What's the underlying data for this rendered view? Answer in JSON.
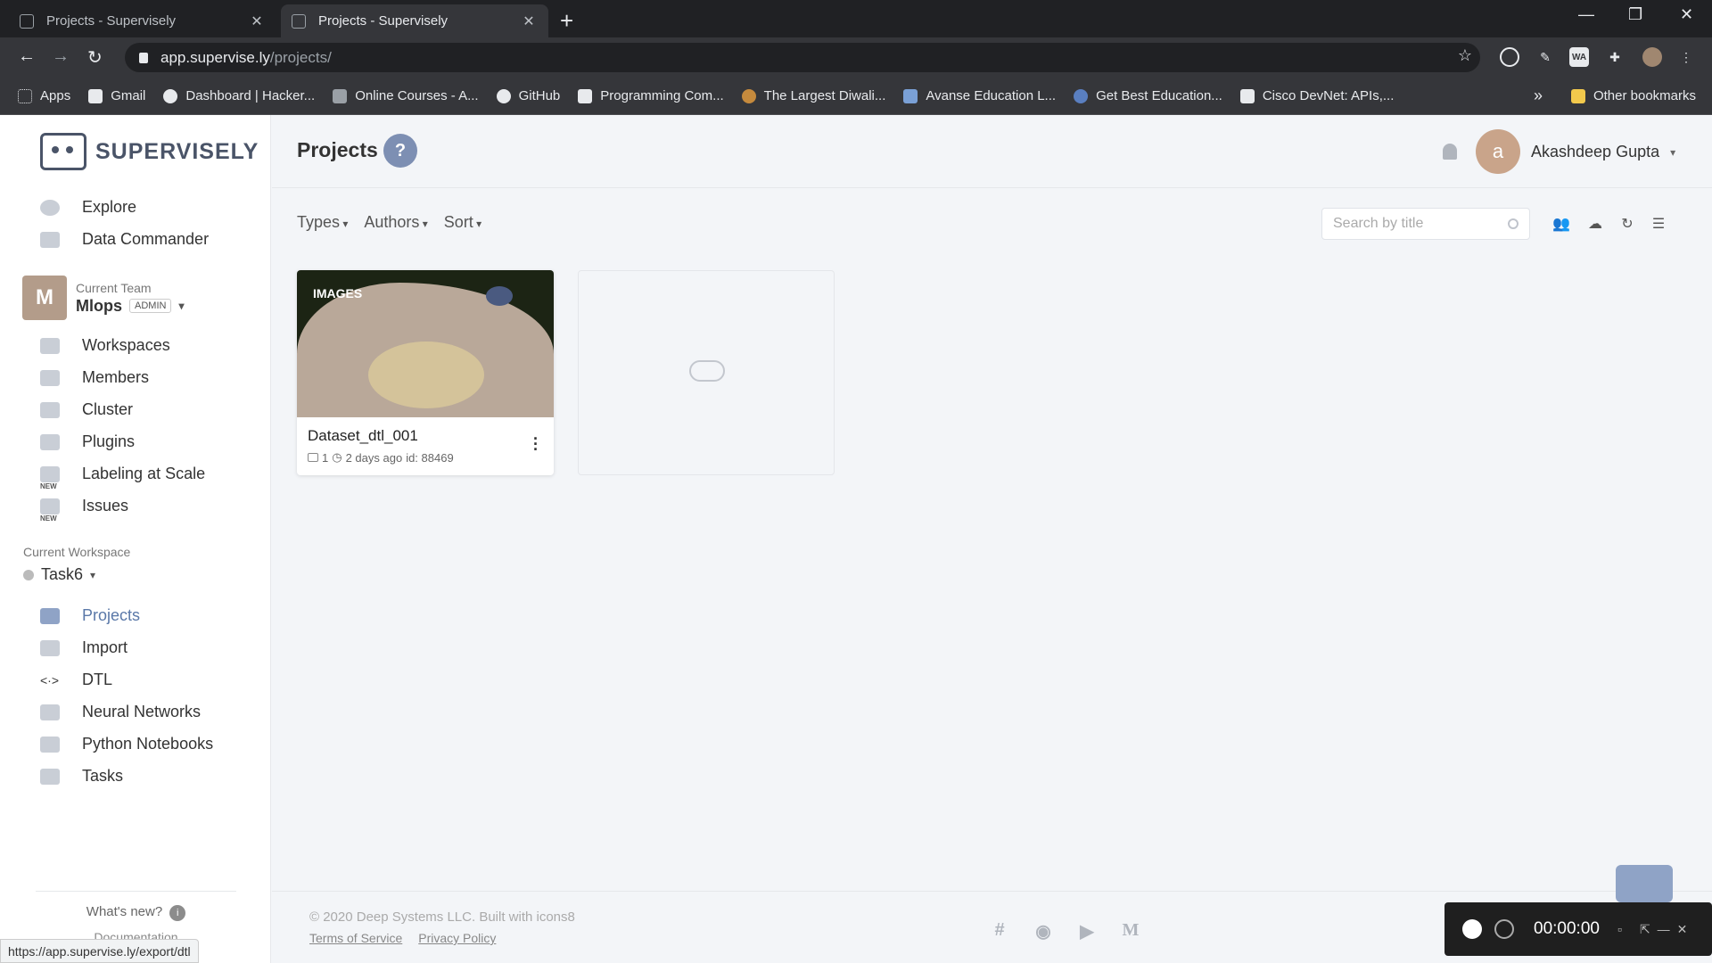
{
  "browser": {
    "tabs": [
      {
        "title": "Projects - Supervisely",
        "active": false
      },
      {
        "title": "Projects - Supervisely",
        "active": true
      }
    ],
    "url_host": "app.supervise.ly",
    "url_path": "/projects/",
    "bookmarks": [
      "Apps",
      "Gmail",
      "Dashboard | Hacker...",
      "Online Courses - A...",
      "GitHub",
      "Programming Com...",
      "The Largest Diwali...",
      "Avanse Education L...",
      "Get Best Education...",
      "Cisco DevNet: APIs,..."
    ],
    "bookmarks_more": "»",
    "other_bookmarks": "Other bookmarks",
    "status_url": "https://app.supervise.ly/export/dtl"
  },
  "sidebar": {
    "logo_text": "SUPERVISELY",
    "top_items": [
      {
        "label": "Explore",
        "icon": "globe-icon"
      },
      {
        "label": "Data Commander",
        "icon": "folder-icon"
      }
    ],
    "team": {
      "label": "Current Team",
      "avatar_letter": "M",
      "name": "Mlops",
      "role": "ADMIN"
    },
    "team_items": [
      {
        "label": "Workspaces",
        "icon": "monitor-icon",
        "new": false
      },
      {
        "label": "Members",
        "icon": "users-icon",
        "new": false
      },
      {
        "label": "Cluster",
        "icon": "server-icon",
        "new": false
      },
      {
        "label": "Plugins",
        "icon": "plugin-icon",
        "new": false
      },
      {
        "label": "Labeling at Scale",
        "icon": "labeling-icon",
        "new": true
      },
      {
        "label": "Issues",
        "icon": "flag-icon",
        "new": true
      }
    ],
    "new_tag": "NEW",
    "workspace": {
      "label": "Current Workspace",
      "name": "Task6"
    },
    "workspace_items": [
      {
        "label": "Projects",
        "icon": "projects-icon",
        "active": true
      },
      {
        "label": "Import",
        "icon": "cloud-upload-icon"
      },
      {
        "label": "DTL",
        "icon": "code-icon"
      },
      {
        "label": "Neural Networks",
        "icon": "brain-icon"
      },
      {
        "label": "Python Notebooks",
        "icon": "notebook-icon"
      },
      {
        "label": "Tasks",
        "icon": "tasks-icon"
      }
    ],
    "whats_new": "What's new?",
    "documentation": "Documentation"
  },
  "header": {
    "title": "Projects",
    "help": "?",
    "user_initial": "a",
    "user_name": "Akashdeep Gupta"
  },
  "filters": {
    "types": "Types",
    "authors": "Authors",
    "sort": "Sort"
  },
  "search": {
    "placeholder": "Search by title"
  },
  "project": {
    "type_tag": "IMAGES",
    "name": "Dataset_dtl_001",
    "datasets": "1",
    "updated": "2 days ago",
    "id_text": "id: 88469"
  },
  "footer": {
    "copyright": "© 2020 Deep Systems LLC. Built with icons8",
    "terms": "Terms of Service",
    "privacy": "Privacy Policy"
  },
  "recorder": {
    "time": "00:00:00"
  }
}
